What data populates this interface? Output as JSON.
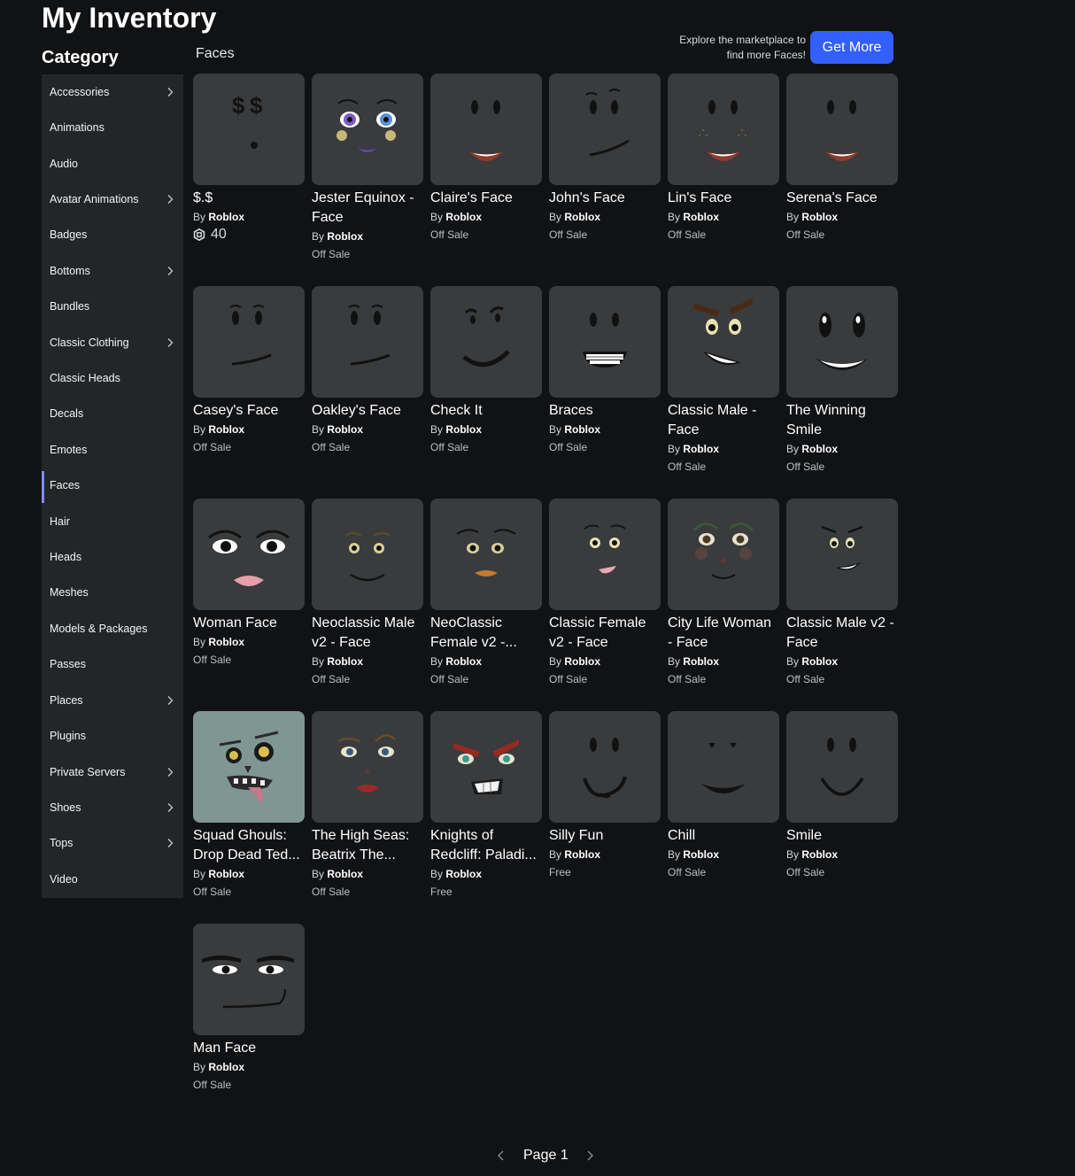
{
  "page": {
    "title": "My Inventory",
    "category_heading": "Category",
    "section_title": "Faces"
  },
  "header": {
    "explore_line1": "Explore the marketplace to",
    "explore_line2": "find more Faces!",
    "get_more": "Get More"
  },
  "sidebar": {
    "items": [
      {
        "label": "Accessories",
        "chevron": true
      },
      {
        "label": "Animations",
        "chevron": false
      },
      {
        "label": "Audio",
        "chevron": false
      },
      {
        "label": "Avatar Animations",
        "chevron": true
      },
      {
        "label": "Badges",
        "chevron": false
      },
      {
        "label": "Bottoms",
        "chevron": true
      },
      {
        "label": "Bundles",
        "chevron": false
      },
      {
        "label": "Classic Clothing",
        "chevron": true
      },
      {
        "label": "Classic Heads",
        "chevron": false
      },
      {
        "label": "Decals",
        "chevron": false
      },
      {
        "label": "Emotes",
        "chevron": false
      },
      {
        "label": "Faces",
        "chevron": false,
        "active": true
      },
      {
        "label": "Hair",
        "chevron": false
      },
      {
        "label": "Heads",
        "chevron": false
      },
      {
        "label": "Meshes",
        "chevron": false
      },
      {
        "label": "Models & Packages",
        "chevron": false
      },
      {
        "label": "Passes",
        "chevron": false
      },
      {
        "label": "Places",
        "chevron": true
      },
      {
        "label": "Plugins",
        "chevron": false
      },
      {
        "label": "Private Servers",
        "chevron": true
      },
      {
        "label": "Shoes",
        "chevron": true
      },
      {
        "label": "Tops",
        "chevron": true
      },
      {
        "label": "Video",
        "chevron": false
      }
    ]
  },
  "items": [
    {
      "name": "$.$",
      "by": "By",
      "creator": "Roblox",
      "price": "40",
      "robux": true
    },
    {
      "name": "Jester Equinox - Face",
      "by": "By",
      "creator": "Roblox",
      "price": "Off Sale"
    },
    {
      "name": "Claire's Face",
      "by": "By",
      "creator": "Roblox",
      "price": "Off Sale"
    },
    {
      "name": "John's Face",
      "by": "By",
      "creator": "Roblox",
      "price": "Off Sale"
    },
    {
      "name": "Lin's Face",
      "by": "By",
      "creator": "Roblox",
      "price": "Off Sale"
    },
    {
      "name": "Serena's Face",
      "by": "By",
      "creator": "Roblox",
      "price": "Off Sale"
    },
    {
      "name": "Casey's Face",
      "by": "By",
      "creator": "Roblox",
      "price": "Off Sale"
    },
    {
      "name": "Oakley's Face",
      "by": "By",
      "creator": "Roblox",
      "price": "Off Sale"
    },
    {
      "name": "Check It",
      "by": "By",
      "creator": "Roblox",
      "price": "Off Sale"
    },
    {
      "name": "Braces",
      "by": "By",
      "creator": "Roblox",
      "price": "Off Sale"
    },
    {
      "name": "Classic Male - Face",
      "by": "By",
      "creator": "Roblox",
      "price": "Off Sale"
    },
    {
      "name": "The Winning Smile",
      "by": "By",
      "creator": "Roblox",
      "price": "Off Sale"
    },
    {
      "name": "Woman Face",
      "by": "By",
      "creator": "Roblox",
      "price": "Off Sale"
    },
    {
      "name": "Neoclassic Male v2 - Face",
      "by": "By",
      "creator": "Roblox",
      "price": "Off Sale"
    },
    {
      "name": "NeoClassic Female v2 -...",
      "by": "By",
      "creator": "Roblox",
      "price": "Off Sale"
    },
    {
      "name": "Classic Female v2 - Face",
      "by": "By",
      "creator": "Roblox",
      "price": "Off Sale"
    },
    {
      "name": "City Life Woman - Face",
      "by": "By",
      "creator": "Roblox",
      "price": "Off Sale"
    },
    {
      "name": "Classic Male v2 - Face",
      "by": "By",
      "creator": "Roblox",
      "price": "Off Sale"
    },
    {
      "name": "Squad Ghouls: Drop Dead Ted...",
      "by": "By",
      "creator": "Roblox",
      "price": "Off Sale"
    },
    {
      "name": "The High Seas: Beatrix The...",
      "by": "By",
      "creator": "Roblox",
      "price": "Off Sale"
    },
    {
      "name": "Knights of Redcliff: Paladi...",
      "by": "By",
      "creator": "Roblox",
      "price": "Free"
    },
    {
      "name": "Silly Fun",
      "by": "By",
      "creator": "Roblox",
      "price": "Free"
    },
    {
      "name": "Chill",
      "by": "By",
      "creator": "Roblox",
      "price": "Off Sale"
    },
    {
      "name": "Smile",
      "by": "By",
      "creator": "Roblox",
      "price": "Off Sale"
    },
    {
      "name": "Man Face",
      "by": "By",
      "creator": "Roblox",
      "price": "Off Sale"
    }
  ],
  "pager": {
    "label": "Page 1"
  },
  "colors": {
    "background": "#111214",
    "sidebar": "#232527",
    "card": "#393b3d",
    "accent": "#335fff",
    "active_indicator": "#7e8cff"
  },
  "icons": {
    "chevron": "chevron-right-icon",
    "robux": "robux-icon",
    "prev": "chevron-left-icon",
    "next": "chevron-right-icon"
  }
}
